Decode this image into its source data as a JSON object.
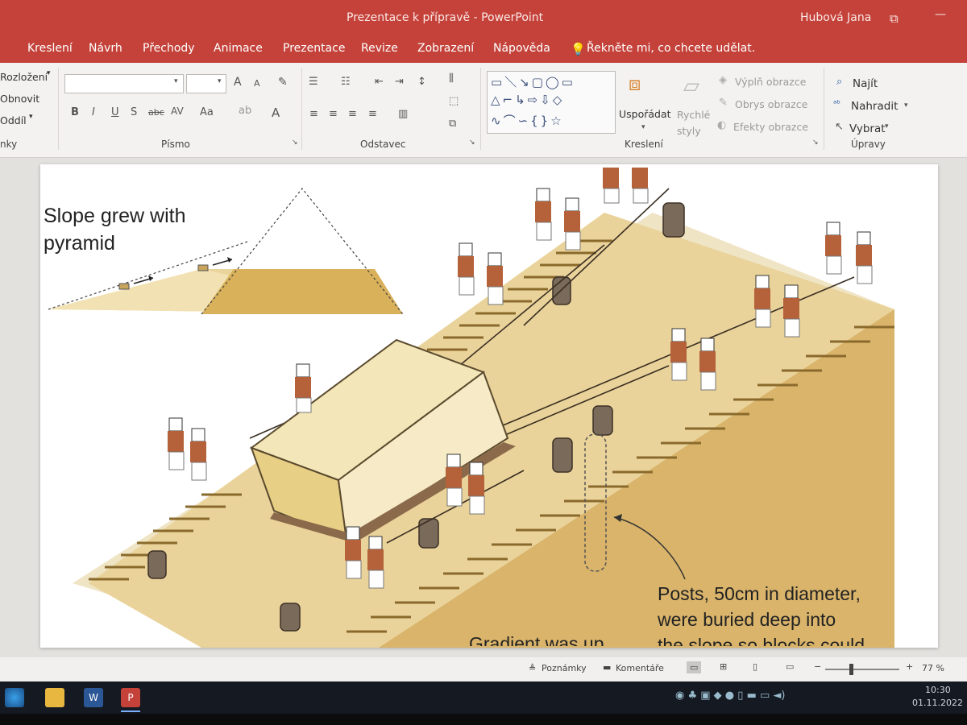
{
  "window": {
    "title": "Prezentace k přípravě  -  PowerPoint",
    "user": "Hubová Jana"
  },
  "tabs": [
    "Kreslení",
    "Návrh",
    "Přechody",
    "Animace",
    "Prezentace",
    "Revize",
    "Zobrazení",
    "Nápověda"
  ],
  "tell_me": "Řekněte mi, co chcete udělat.",
  "ribbon": {
    "slides": {
      "layout": "Rozložení",
      "reset": "Obnovit",
      "section": "Oddíl",
      "label": "nky"
    },
    "font": {
      "label": "Písmo",
      "bold": "B",
      "italic": "I",
      "underline": "U",
      "shadow": "S",
      "strike": "abc",
      "spacing": "AV",
      "case": "Aa",
      "grow": "A",
      "shrink": "A",
      "color": "A"
    },
    "paragraph": {
      "label": "Odstavec"
    },
    "drawing": {
      "label": "Kreslení",
      "arrange": "Uspořádat",
      "quick_styles_1": "Rychlé",
      "quick_styles_2": "styly",
      "fill": "Výplň obrazce",
      "outline": "Obrys obrazce",
      "effects": "Efekty obrazce"
    },
    "editing": {
      "label": "Úpravy",
      "find": "Najít",
      "replace": "Nahradit",
      "select": "Vybrat"
    }
  },
  "slide": {
    "caption_top_1": "Slope grew with",
    "caption_top_2": "pyramid",
    "caption_posts_1": "Posts, 50cm in diameter,",
    "caption_posts_2": "were buried deep into",
    "caption_cut_1": "Gradient was up",
    "caption_cut_2": "the slope so blocks could"
  },
  "status": {
    "notes": "Poznámky",
    "comments": "Komentáře",
    "zoom": "77 %"
  },
  "clock": {
    "time": "10:30",
    "date": "01.11.2022"
  },
  "colors": {
    "accent": "#c4423a",
    "sand": "#e6cf96",
    "stone": "#f0dfa8",
    "skin": "#b5613a"
  }
}
